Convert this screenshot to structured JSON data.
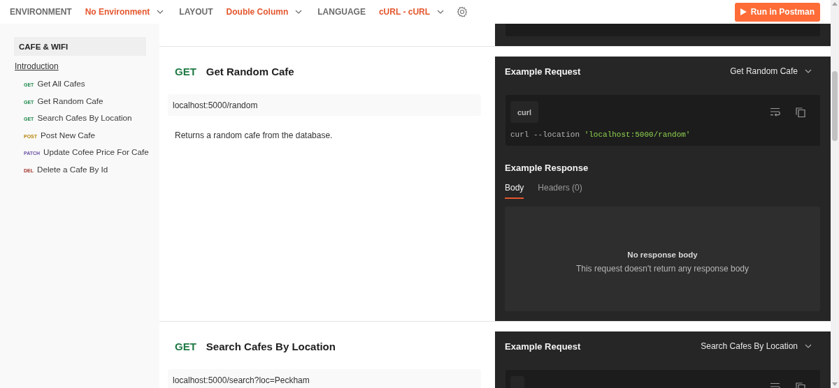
{
  "toolbar": {
    "settings": [
      {
        "label": "ENVIRONMENT",
        "value": "No Environment"
      },
      {
        "label": "LAYOUT",
        "value": "Double Column"
      },
      {
        "label": "LANGUAGE",
        "value": "cURL - cURL"
      }
    ],
    "run_button": "Run in Postman"
  },
  "sidebar": {
    "title": "CAFE & WIFI",
    "intro_link": "Introduction",
    "items": [
      {
        "method": "GET",
        "label": "Get All Cafes",
        "color": "#1f8a4c"
      },
      {
        "method": "GET",
        "label": "Get Random Cafe",
        "color": "#1f8a4c"
      },
      {
        "method": "GET",
        "label": "Search Cafes By Location",
        "color": "#1f8a4c"
      },
      {
        "method": "POST",
        "label": "Post New Cafe",
        "color": "#b8860b"
      },
      {
        "method": "PATCH",
        "label": "Update Cofee Price For Cafe",
        "color": "#6e55a6"
      },
      {
        "method": "DEL",
        "label": "Delete a Cafe By Id",
        "color": "#a3342a"
      }
    ]
  },
  "sections": [
    {
      "method": "GET",
      "title": "Get Random Cafe",
      "url": "localhost:5000/random",
      "description": "Returns a random cafe from the database.",
      "example": {
        "heading": "Example Request",
        "selector": "Get Random Cafe",
        "language": "curl",
        "code": [
          {
            "kind": "plain",
            "text": "curl --location "
          },
          {
            "kind": "string",
            "text": "'localhost:5000/random'"
          }
        ]
      },
      "response": {
        "heading": "Example Response",
        "tabs": [
          {
            "label": "Body",
            "selected": true
          },
          {
            "label": "Headers (0)",
            "selected": false
          }
        ],
        "empty_title": "No response body",
        "empty_text": "This request doesn't return any response body"
      }
    },
    {
      "method": "GET",
      "title": "Search Cafes By Location",
      "url": "localhost:5000/search?loc=Peckham",
      "example": {
        "heading": "Example Request",
        "selector": "Search Cafes By Location"
      }
    }
  ]
}
